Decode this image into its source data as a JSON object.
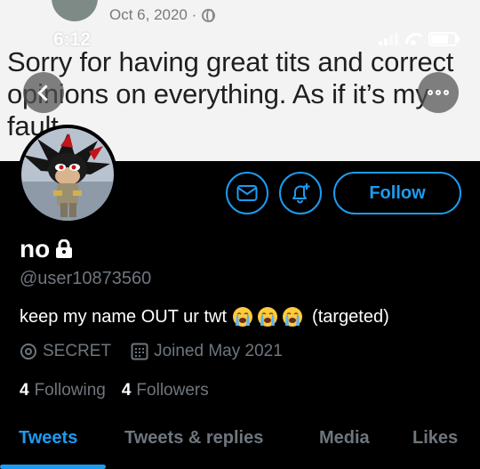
{
  "banner": {
    "date": "Oct 6, 2020 ·",
    "status_time": "6:12",
    "tweet_text": "Sorry for having great tits and correct opinions on everything. As if it’s my fault"
  },
  "header": {
    "back_icon": "chevron-left-icon",
    "more_icon": "more-icon"
  },
  "actions": {
    "mail_icon": "mail-icon",
    "notify_icon": "bell-plus-icon",
    "follow_label": "Follow"
  },
  "profile": {
    "display_name": "no",
    "protected_icon": "lock-icon",
    "handle": "@user10873560",
    "bio_start": "keep my name OUT ur twt",
    "bio_end": "(targeted)",
    "bio_emoji": "loudly-crying-face-emoji",
    "location": "SECRET",
    "joined": "Joined May 2021",
    "following_count": "4",
    "following_label": "Following",
    "followers_count": "4",
    "followers_label": "Followers"
  },
  "tabs": [
    {
      "label": "Tweets",
      "active": true
    },
    {
      "label": "Tweets & replies",
      "active": false
    },
    {
      "label": "Media",
      "active": false
    },
    {
      "label": "Likes",
      "active": false
    }
  ],
  "colors": {
    "accent": "#1d9bf0",
    "muted": "#6e767d",
    "background": "#000000"
  }
}
